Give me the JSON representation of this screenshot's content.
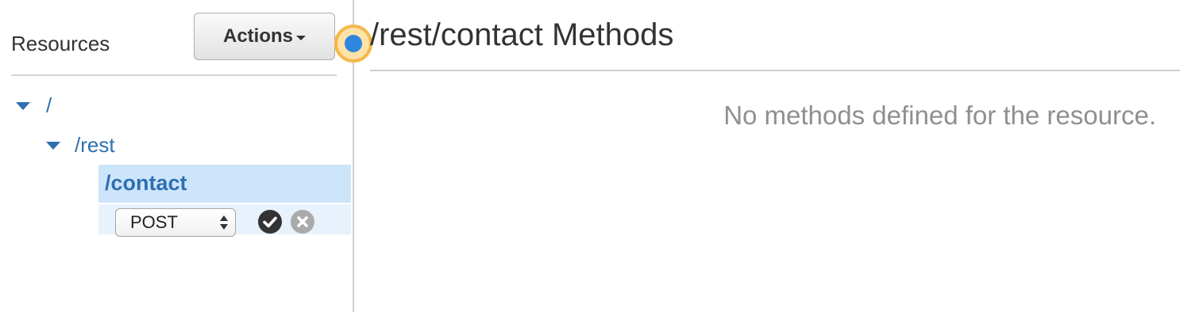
{
  "sidebar": {
    "title": "Resources",
    "actions_label": "Actions",
    "tree": {
      "root": "/",
      "rest": "/rest",
      "contact": "/contact"
    },
    "method_select": {
      "value": "POST"
    }
  },
  "main": {
    "title": "/rest/contact Methods",
    "empty_message": "No methods defined for the resource."
  },
  "colors": {
    "link": "#2d6fb0",
    "selected_bg": "#cde5fb",
    "marker_ring": "#f5b84a",
    "marker_dot": "#2f86e0"
  },
  "icons": {
    "caret": "chevron-down-icon",
    "expand": "tree-expand-icon",
    "confirm": "check-circle-icon",
    "cancel": "close-circle-icon"
  }
}
